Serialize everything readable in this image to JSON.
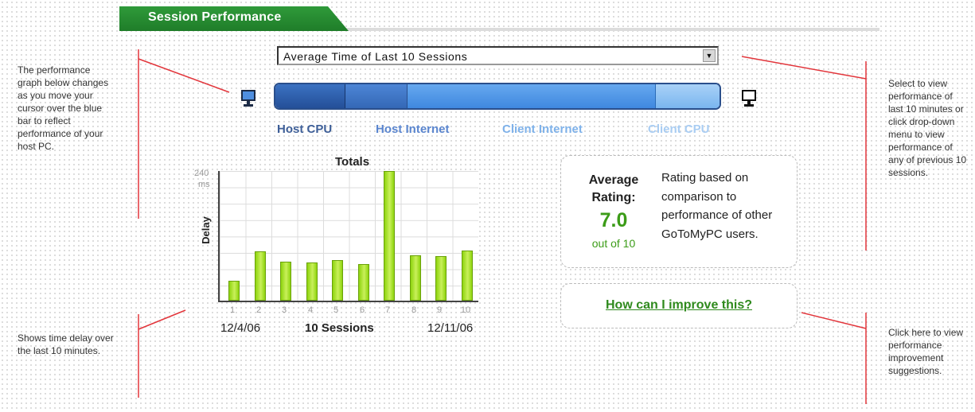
{
  "header": {
    "title": "Session Performance"
  },
  "dropdown": {
    "selected": "Average Time of Last 10 Sessions"
  },
  "performance_bar": {
    "segments": [
      "Host CPU",
      "Host Internet",
      "Client Internet",
      "Client CPU"
    ],
    "colors": [
      "#2e5fae",
      "#3f78c8",
      "#5a9ae8",
      "#93c4f4"
    ]
  },
  "chart": {
    "title": "Totals",
    "ylabel": "Delay",
    "ytick_top": "240",
    "ytick_unit": "ms",
    "xlabel": "10 Sessions",
    "x_start": "12/4/06",
    "x_end": "12/11/06"
  },
  "chart_data": {
    "type": "bar",
    "title": "Totals",
    "xlabel": "10 Sessions",
    "ylabel": "Delay",
    "categories": [
      "1",
      "2",
      "3",
      "4",
      "5",
      "6",
      "7",
      "8",
      "9",
      "10"
    ],
    "values": [
      37,
      92,
      72,
      71,
      75,
      68,
      240,
      84,
      82,
      93
    ],
    "ylim": [
      0,
      240
    ],
    "color": "#9fe01a"
  },
  "rating": {
    "label": "Average Rating:",
    "value": "7.0",
    "out_of": "out of 10",
    "description": "Rating based on comparison to performance of other GoToMyPC users."
  },
  "improve": {
    "link": "How can I improve this?"
  },
  "annotations": {
    "left_top": "The performance graph below changes as you move your cursor over the blue bar to reflect performance of your host PC.",
    "left_bottom": "Shows time delay over the last 10 minutes.",
    "right_top": "Select to view performance of last 10 minutes or click drop-down menu to view performance of any of previous 10 sessions.",
    "right_bottom": "Click here to view performance improvement suggestions."
  }
}
